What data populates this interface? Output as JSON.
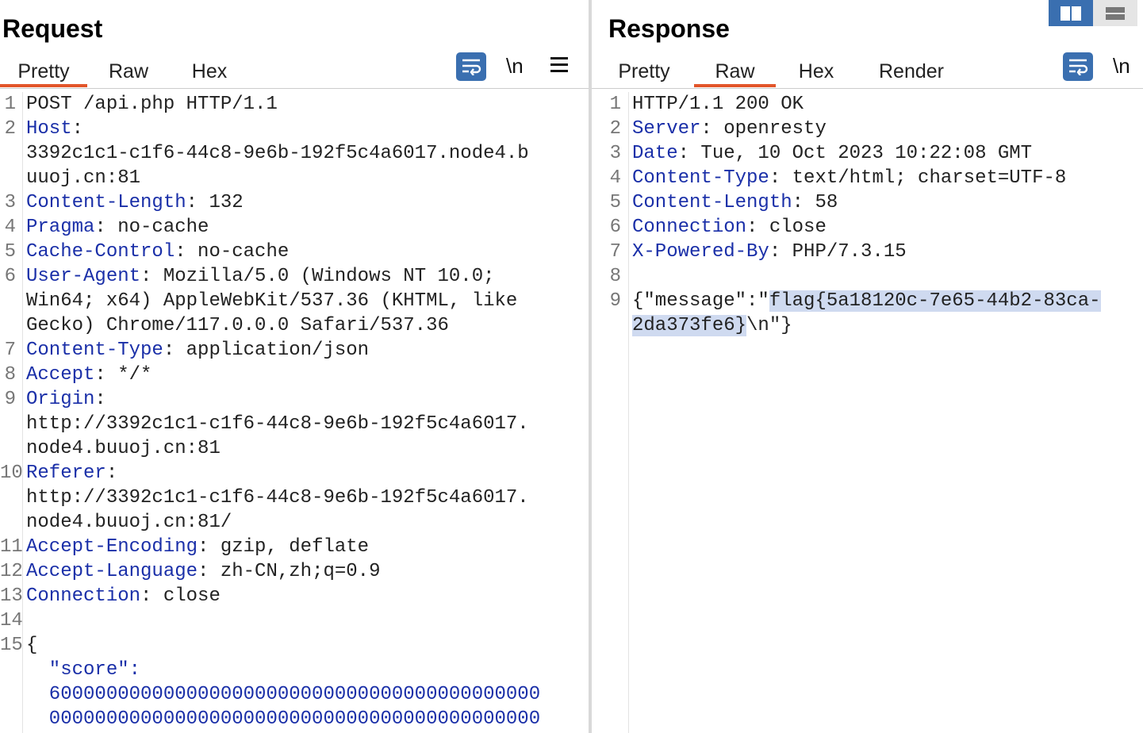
{
  "request": {
    "title": "Request",
    "tabs": [
      "Pretty",
      "Raw",
      "Hex"
    ],
    "active_tab": "Pretty",
    "tools": {
      "wrap_icon": "wrap-lines-icon",
      "newline_label": "\\n",
      "menu_icon": "hamburger-menu-icon"
    },
    "lines": [
      {
        "n": "1",
        "parts": [
          {
            "t": "POST /api.php HTTP/1.1",
            "c": ""
          }
        ]
      },
      {
        "n": "2",
        "parts": [
          {
            "t": "Host",
            "c": "hname"
          },
          {
            "t": ":",
            "c": ""
          }
        ]
      },
      {
        "n": "",
        "parts": [
          {
            "t": "3392c1c1-c1f6-44c8-9e6b-192f5c4a6017.node4.b",
            "c": ""
          }
        ]
      },
      {
        "n": "",
        "parts": [
          {
            "t": "uuoj.cn:81",
            "c": ""
          }
        ]
      },
      {
        "n": "3",
        "parts": [
          {
            "t": "Content-Length",
            "c": "hname"
          },
          {
            "t": ": 132",
            "c": ""
          }
        ]
      },
      {
        "n": "4",
        "parts": [
          {
            "t": "Pragma",
            "c": "hname"
          },
          {
            "t": ": no-cache",
            "c": ""
          }
        ]
      },
      {
        "n": "5",
        "parts": [
          {
            "t": "Cache-Control",
            "c": "hname"
          },
          {
            "t": ": no-cache",
            "c": ""
          }
        ]
      },
      {
        "n": "6",
        "parts": [
          {
            "t": "User-Agent",
            "c": "hname"
          },
          {
            "t": ": Mozilla/5.0 (Windows NT 10.0;",
            "c": ""
          }
        ]
      },
      {
        "n": "",
        "parts": [
          {
            "t": "Win64; x64) AppleWebKit/537.36 (KHTML, like",
            "c": ""
          }
        ]
      },
      {
        "n": "",
        "parts": [
          {
            "t": "Gecko) Chrome/117.0.0.0 Safari/537.36",
            "c": ""
          }
        ]
      },
      {
        "n": "7",
        "parts": [
          {
            "t": "Content-Type",
            "c": "hname"
          },
          {
            "t": ": application/json",
            "c": ""
          }
        ]
      },
      {
        "n": "8",
        "parts": [
          {
            "t": "Accept",
            "c": "hname"
          },
          {
            "t": ": */*",
            "c": ""
          }
        ]
      },
      {
        "n": "9",
        "parts": [
          {
            "t": "Origin",
            "c": "hname"
          },
          {
            "t": ":",
            "c": ""
          }
        ]
      },
      {
        "n": "",
        "parts": [
          {
            "t": "http://3392c1c1-c1f6-44c8-9e6b-192f5c4a6017.",
            "c": ""
          }
        ]
      },
      {
        "n": "",
        "parts": [
          {
            "t": "node4.buuoj.cn:81",
            "c": ""
          }
        ]
      },
      {
        "n": "10",
        "parts": [
          {
            "t": "Referer",
            "c": "hname"
          },
          {
            "t": ":",
            "c": ""
          }
        ]
      },
      {
        "n": "",
        "parts": [
          {
            "t": "http://3392c1c1-c1f6-44c8-9e6b-192f5c4a6017.",
            "c": ""
          }
        ]
      },
      {
        "n": "",
        "parts": [
          {
            "t": "node4.buuoj.cn:81/",
            "c": ""
          }
        ]
      },
      {
        "n": "11",
        "parts": [
          {
            "t": "Accept-Encoding",
            "c": "hname"
          },
          {
            "t": ": gzip, deflate",
            "c": ""
          }
        ]
      },
      {
        "n": "12",
        "parts": [
          {
            "t": "Accept-Language",
            "c": "hname"
          },
          {
            "t": ": zh-CN,zh;q=0.9",
            "c": ""
          }
        ]
      },
      {
        "n": "13",
        "parts": [
          {
            "t": "Connection",
            "c": "hname"
          },
          {
            "t": ": close",
            "c": ""
          }
        ]
      },
      {
        "n": "14",
        "parts": [
          {
            "t": "",
            "c": ""
          }
        ]
      },
      {
        "n": "15",
        "parts": [
          {
            "t": "{",
            "c": ""
          }
        ]
      },
      {
        "n": "",
        "parts": [
          {
            "t": "  \"score\":",
            "c": "blue"
          }
        ]
      },
      {
        "n": "",
        "parts": [
          {
            "t": "  6000000000000000000000000000000000000000000",
            "c": "blue"
          }
        ]
      },
      {
        "n": "",
        "parts": [
          {
            "t": "  0000000000000000000000000000000000000000000",
            "c": "blue"
          }
        ]
      }
    ]
  },
  "response": {
    "title": "Response",
    "tabs": [
      "Pretty",
      "Raw",
      "Hex",
      "Render"
    ],
    "active_tab": "Raw",
    "tools": {
      "wrap_icon": "wrap-lines-icon",
      "newline_label": "\\n"
    },
    "lines": [
      {
        "n": "1",
        "parts": [
          {
            "t": "HTTP/1.1 200 OK",
            "c": ""
          }
        ]
      },
      {
        "n": "2",
        "parts": [
          {
            "t": "Server",
            "c": "hname"
          },
          {
            "t": ": openresty",
            "c": ""
          }
        ]
      },
      {
        "n": "3",
        "parts": [
          {
            "t": "Date",
            "c": "hname"
          },
          {
            "t": ": Tue, 10 Oct 2023 10:22:08 GMT",
            "c": ""
          }
        ]
      },
      {
        "n": "4",
        "parts": [
          {
            "t": "Content-Type",
            "c": "hname"
          },
          {
            "t": ": text/html; charset=UTF-8",
            "c": ""
          }
        ]
      },
      {
        "n": "5",
        "parts": [
          {
            "t": "Content-Length",
            "c": "hname"
          },
          {
            "t": ": 58",
            "c": ""
          }
        ]
      },
      {
        "n": "6",
        "parts": [
          {
            "t": "Connection",
            "c": "hname"
          },
          {
            "t": ": close",
            "c": ""
          }
        ]
      },
      {
        "n": "7",
        "parts": [
          {
            "t": "X-Powered-By",
            "c": "hname"
          },
          {
            "t": ": PHP/7.3.15",
            "c": ""
          }
        ]
      },
      {
        "n": "8",
        "parts": [
          {
            "t": "",
            "c": ""
          }
        ]
      },
      {
        "n": "9",
        "parts": [
          {
            "t": "{\"message\":\"",
            "c": ""
          },
          {
            "t": "flag{5a18120c-7e65-44b2-83ca-",
            "c": "hl"
          }
        ]
      },
      {
        "n": "",
        "parts": [
          {
            "t": "2da373fe6}",
            "c": "hl"
          },
          {
            "t": "\\n\"}",
            "c": ""
          }
        ]
      }
    ]
  },
  "view_toggle": {
    "split_icon": "side-by-side-layout-icon",
    "stack_icon": "stacked-layout-icon"
  },
  "colors": {
    "accent": "#3a6fb0",
    "active_tab_underline": "#e2552a",
    "header_name": "#1a2fa8",
    "selection": "#cfdaf0"
  }
}
